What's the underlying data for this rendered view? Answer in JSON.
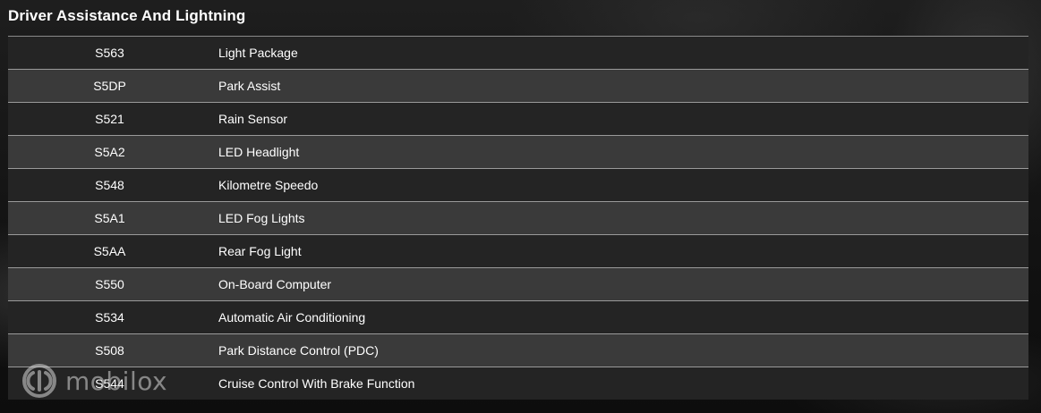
{
  "section": {
    "title": "Driver Assistance And Lightning"
  },
  "table": {
    "rows": [
      {
        "code": "S563",
        "description": "Light Package"
      },
      {
        "code": "S5DP",
        "description": "Park Assist"
      },
      {
        "code": "S521",
        "description": "Rain Sensor"
      },
      {
        "code": "S5A2",
        "description": "LED Headlight"
      },
      {
        "code": "S548",
        "description": "Kilometre Speedo"
      },
      {
        "code": "S5A1",
        "description": "LED Fog Lights"
      },
      {
        "code": "S5AA",
        "description": "Rear Fog Light"
      },
      {
        "code": "S550",
        "description": "On-Board Computer"
      },
      {
        "code": "S534",
        "description": "Automatic Air Conditioning"
      },
      {
        "code": "S508",
        "description": "Park Distance Control (PDC)"
      },
      {
        "code": "S544",
        "description": "Cruise Control With Brake Function"
      }
    ]
  },
  "watermark": {
    "text": "mobilox",
    "icon": "mobilox-logo-icon"
  },
  "colors": {
    "row_dark": "#242424",
    "row_light": "#3a3a3a",
    "divider": "#9a9a9a",
    "text": "#ffffff"
  }
}
